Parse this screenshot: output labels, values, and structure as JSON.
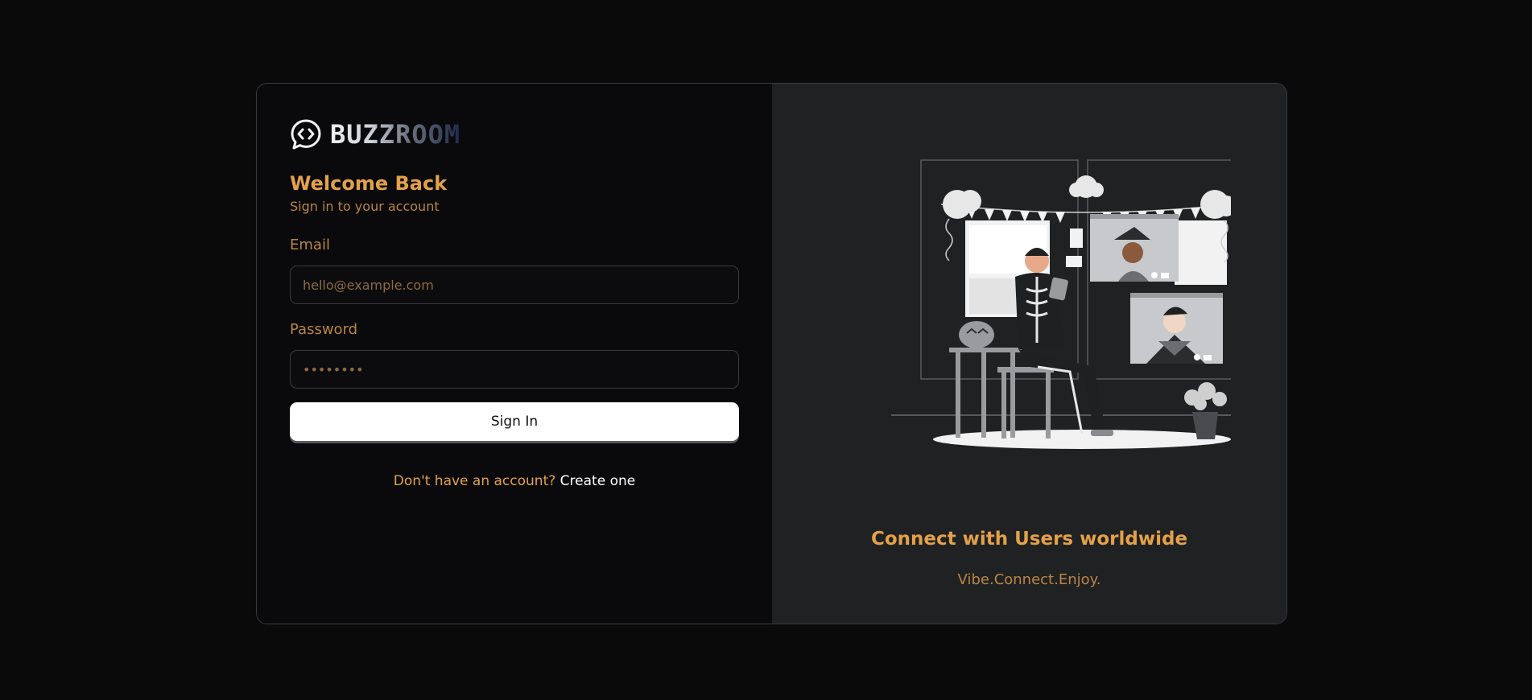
{
  "brand": {
    "name": "BUZZROOM",
    "icon": "chat-bubble-code-icon"
  },
  "login": {
    "title": "Welcome Back",
    "subtitle": "Sign in to your account",
    "email_label": "Email",
    "email_placeholder": "hello@example.com",
    "password_label": "Password",
    "password_placeholder": "••••••••",
    "submit_label": "Sign In",
    "signup_prompt": "Don't have an account?",
    "signup_link": "Create one"
  },
  "promo": {
    "illustration": "video-call-party-illustration",
    "heading": "Connect with Users worldwide",
    "subheading": "Vibe.Connect.Enjoy."
  },
  "colors": {
    "background": "#0a0a0b",
    "panel_left": "#0a0a0c",
    "panel_right": "#202123",
    "accent": "#e3a149",
    "accent_muted": "#b98545",
    "button_bg": "#ffffff"
  }
}
